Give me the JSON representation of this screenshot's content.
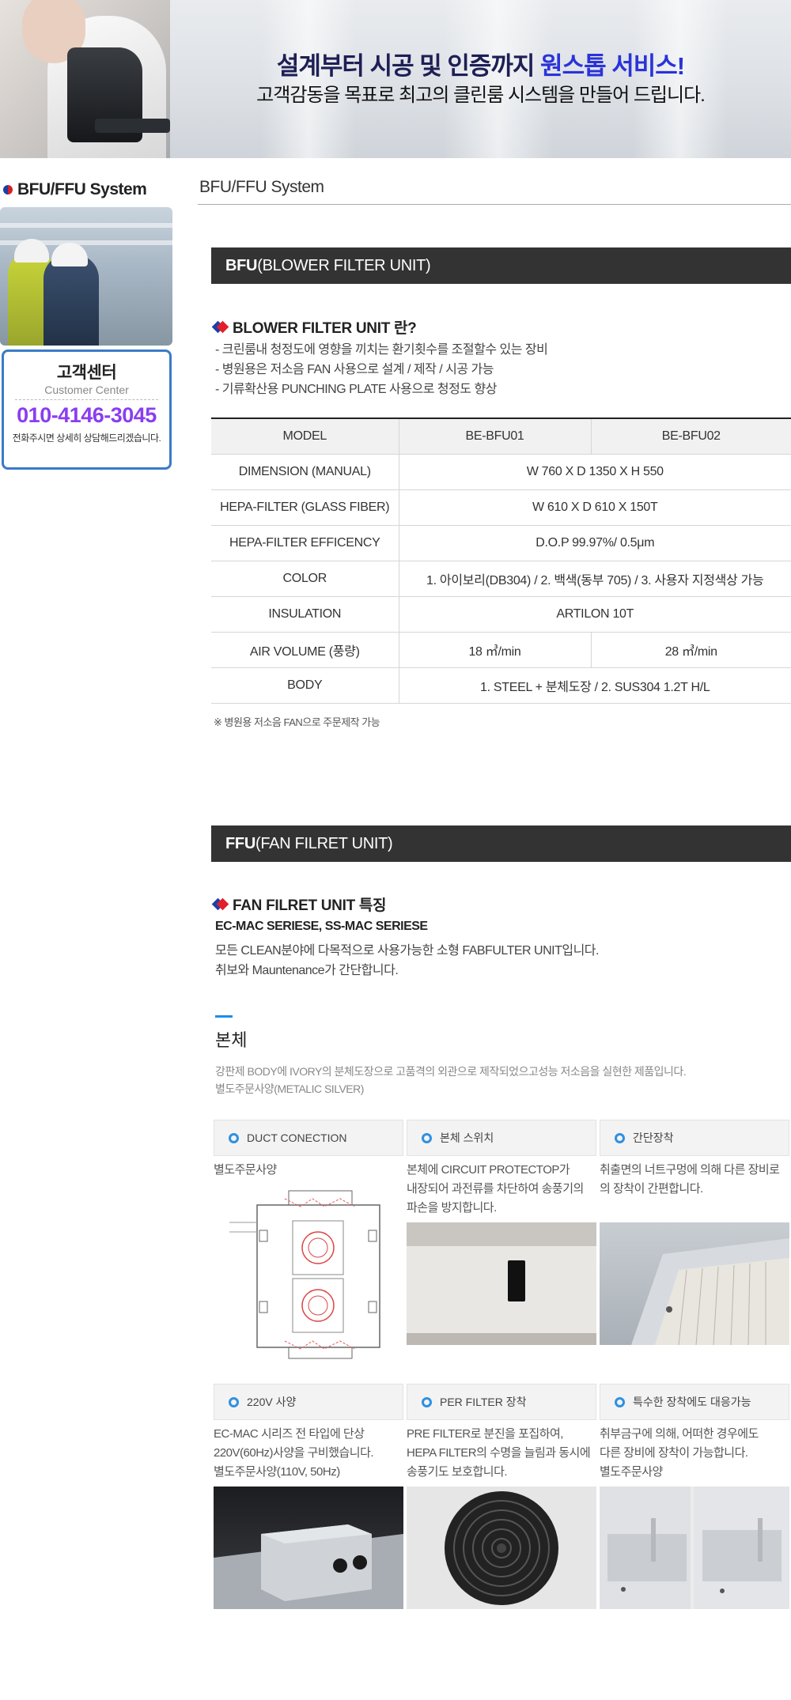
{
  "hero": {
    "line1_a": "설계부터 시공 및 인증까지 ",
    "line1_b": "원스톱 서비스!",
    "line2": "고객감동을 목표로 최고의 클린룸 시스템을 만들어 드립니다."
  },
  "sidebar": {
    "title": "BFU/FFU System",
    "customer_center": {
      "title": "고객센터",
      "subtitle": "Customer Center",
      "phone": "010-4146-3045",
      "note": "전화주시면 상세히 상담해드리겠습니다."
    }
  },
  "page": {
    "title": "BFU/FFU System"
  },
  "bfu": {
    "bar_bold": "BFU",
    "bar_rest": "(BLOWER FILTER UNIT)",
    "heading": "BLOWER FILTER UNIT 란?",
    "bullets": [
      "- 크린룸내 청정도에 영향을 끼치는 환기횟수를 조절할수 있는 장비",
      "- 병원용은 저소음 FAN 사용으로 설계 / 제작 / 시공 가능",
      "- 기류확산용 PUNCHING PLATE 사용으로 청정도 향상"
    ],
    "table": {
      "headers": [
        "MODEL",
        "BE-BFU01",
        "BE-BFU02"
      ],
      "rows": [
        {
          "label": "DIMENSION (MANUAL)",
          "value": "W 760 X D 1350 X H 550"
        },
        {
          "label": "HEPA-FILTER (GLASS FIBER)",
          "value": "W 610 X D 610 X 150T"
        },
        {
          "label": "HEPA-FILTER EFFICENCY",
          "value": "D.O.P 99.97%/ 0.5μm"
        },
        {
          "label": "COLOR",
          "value": "1. 아이보리(DB304) / 2. 백색(동부 705) / 3. 사용자 지정색상 가능"
        },
        {
          "label": "INSULATION",
          "value": "ARTILON 10T"
        },
        {
          "label": "AIR VOLUME (풍량)",
          "value1": "18 ㎥/min",
          "value2": "28 ㎥/min"
        },
        {
          "label": "BODY",
          "value": "1. STEEL + 분체도장 / 2. SUS304 1.2T H/L"
        }
      ]
    },
    "note": "※ 병원용 저소음 FAN으로 주문제작 가능"
  },
  "ffu": {
    "bar_bold": "FFU",
    "bar_rest": "(FAN FILRET UNIT)",
    "heading": "FAN FILRET UNIT 특징",
    "sub_bold": "EC-MAC SERIESE, SS-MAC SERIESE",
    "sub_lines": [
      "모든 CLEAN분야에 다목적으로 사용가능한 소형 FABFULTER UNIT입니다.",
      "취보와 Mauntenance가 간단합니다."
    ],
    "body_title": "본체",
    "body_desc": [
      "강판제 BODY에 IVORY의 분체도장으로 고품격의 외관으로 제작되었으고성능 저소음을 실현한 제품입니다.",
      "별도주문사양(METALIC SILVER)"
    ],
    "cards": [
      {
        "title": "DUCT CONECTION",
        "text": [
          "별도주문사양"
        ],
        "image": "duct-diagram"
      },
      {
        "title": "본체 스위치",
        "text": [
          "본체에 CIRCUIT PROTECTOP가",
          "내장되어 과전류를 차단하여 송풍기의",
          "파손을 방지합니다."
        ],
        "image": "switch-panel"
      },
      {
        "title": "간단장착",
        "text": [
          "취출면의 너트구멍에 의해 다른 장비로",
          "의 장착이 간편합니다."
        ],
        "image": "filter-frame"
      },
      {
        "title": "220V 사양",
        "text": [
          "EC-MAC 시리즈 전 타입에 단상",
          "220V(60Hz)사양을 구비했습니다.",
          "별도주문사양(110V, 50Hz)"
        ],
        "image": "electric-box"
      },
      {
        "title": "PER FILTER 장착",
        "text": [
          "PRE FILTER로 분진을 포집하여,",
          "HEPA FILTER의 수명을 늘림과 동시에",
          "송풍기도 보호합니다."
        ],
        "image": "fan-guard"
      },
      {
        "title": "특수한 장착에도 대응가능",
        "text": [
          "취부금구에 의해, 어떠한 경우에도",
          "다른 장비에 장착이 가능합니다.",
          "별도주문사양"
        ],
        "image": "mount-brackets"
      }
    ]
  },
  "colors": {
    "accent_blue": "#2a33d8",
    "phone_purple": "#8a3df0",
    "bar_dark": "#333333",
    "ring_blue": "#2f90e0"
  }
}
